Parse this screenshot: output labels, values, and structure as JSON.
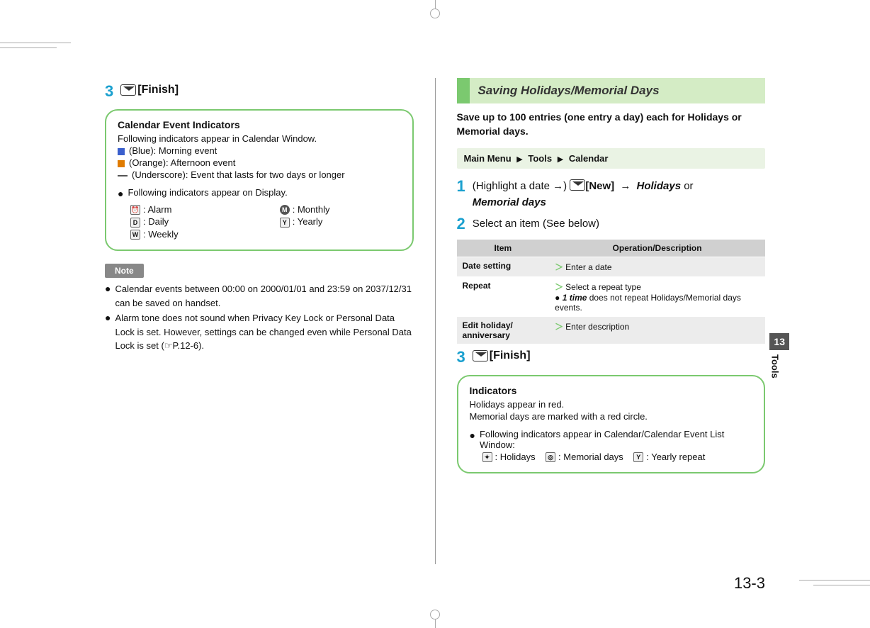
{
  "left": {
    "step3_num": "3",
    "finish": "[Finish]",
    "indicators_title": "Calendar Event Indicators",
    "indicators_sub": "Following indicators appear in Calendar Window.",
    "blue_label": "(Blue): Morning event",
    "orange_label": "(Orange): Afternoon event",
    "underscore_label": "(Underscore): Event that lasts for two days or longer",
    "display_intro": "Following indicators appear on Display.",
    "alarm": ": Alarm",
    "daily": ": Daily",
    "weekly": ": Weekly",
    "monthly": ": Monthly",
    "yearly": ": Yearly",
    "note_label": "Note",
    "note1": "Calendar events between 00:00 on 2000/01/01 and 23:59 on 2037/12/31 can be saved on handset.",
    "note2": "Alarm tone does not sound when Privacy Key Lock or Personal Data Lock is set. However, settings can be changed even while Personal Data Lock is set (☞P.12-6)."
  },
  "right": {
    "section_title": "Saving Holidays/Memorial Days",
    "intro": "Save up to 100 entries (one entry a day) each for Holidays or Memorial days.",
    "menu_main": "Main Menu",
    "menu_tools": "Tools",
    "menu_calendar": "Calendar",
    "step1_num": "1",
    "step1_a": "(Highlight a date →)",
    "step1_new": "[New]",
    "step1_b": " → ",
    "step1_holidays": "Holidays",
    "step1_or": " or ",
    "step1_memorial": "Memorial days",
    "step2_num": "2",
    "step2_text": "Select an item (See below)",
    "th_item": "Item",
    "th_op": "Operation/Description",
    "row1_item": "Date setting",
    "row1_op": "Enter a date",
    "row2_item": "Repeat",
    "row2_op_a": "Select a repeat type",
    "row2_op_b": "1 time",
    "row2_op_c": " does not repeat Holidays/Memorial days events.",
    "row3_item": "Edit holiday/ anniversary",
    "row3_op": "Enter description",
    "step3_num": "3",
    "finish": "[Finish]",
    "indicators_title": "Indicators",
    "ind_a": "Holidays appear in red.",
    "ind_b": "Memorial days are marked with a red circle.",
    "ind_intro": "Following indicators appear in Calendar/Calendar Event List Window:",
    "ind_holidays": ": Holidays",
    "ind_memorial": ": Memorial days",
    "ind_yearly": ": Yearly repeat"
  },
  "side": {
    "chapter": "13",
    "label": "Tools"
  },
  "page_number": "13-3"
}
